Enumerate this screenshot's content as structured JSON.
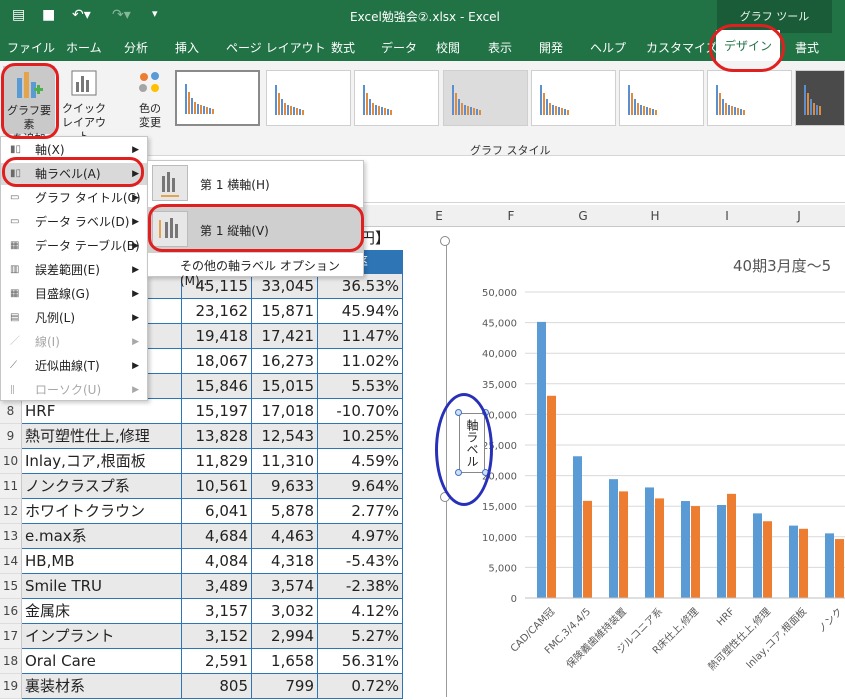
{
  "window": {
    "title": "Excel勉強会②.xlsx  -  Excel",
    "context_tab": "グラフ ツール",
    "quick_access": [
      "save-icon",
      "undo-icon",
      "redo-icon",
      "customize-icon"
    ]
  },
  "menu": {
    "items": [
      "ファイル",
      "ホーム",
      "分析",
      "挿入",
      "ページ レイアウト",
      "数式",
      "データ",
      "校閲",
      "表示",
      "開発",
      "ヘルプ",
      "カスタマイズ",
      "デザイン",
      "書式"
    ],
    "active": "デザイン"
  },
  "ribbon": {
    "add_element": "グラフ要素を追加",
    "add_element_l1": "グラフ要素",
    "add_element_l2": "を追加",
    "quick_layout_l1": "クイック",
    "quick_layout_l2": "レイアウト",
    "colors_l1": "色の",
    "colors_l2": "変更",
    "group_label": "グラフ スタイル"
  },
  "element_menu": [
    {
      "label": "軸(X)",
      "enabled": true,
      "submenu": true
    },
    {
      "label": "軸ラベル(A)",
      "enabled": true,
      "submenu": true
    },
    {
      "label": "グラフ タイトル(C)",
      "enabled": true,
      "submenu": true
    },
    {
      "label": "データ ラベル(D)",
      "enabled": true,
      "submenu": true
    },
    {
      "label": "データ テーブル(B)",
      "enabled": true,
      "submenu": true
    },
    {
      "label": "誤差範囲(E)",
      "enabled": true,
      "submenu": true
    },
    {
      "label": "目盛線(G)",
      "enabled": true,
      "submenu": true
    },
    {
      "label": "凡例(L)",
      "enabled": true,
      "submenu": true
    },
    {
      "label": "線(I)",
      "enabled": false,
      "submenu": true
    },
    {
      "label": "近似曲線(T)",
      "enabled": true,
      "submenu": true
    },
    {
      "label": "ローソク(U)",
      "enabled": false,
      "submenu": true
    }
  ],
  "axis_label_submenu": {
    "primary_horizontal": "第 1 横軸(H)",
    "primary_vertical": "第 1 縦軸(V)",
    "more_options": "その他の軸ラベル オプション(M)..."
  },
  "sheet": {
    "columns": [
      "E",
      "F",
      "G",
      "H",
      "I",
      "J"
    ],
    "partial_header": "円】",
    "rate_header": "率",
    "row_numbers": [
      "8",
      "9",
      "10",
      "11",
      "12",
      "13",
      "14",
      "15",
      "16",
      "17",
      "18",
      "19"
    ],
    "top_rows": [
      {
        "name": "",
        "a": "45,115",
        "b": "33,045",
        "c": "36.53%"
      },
      {
        "name": "",
        "a": "23,162",
        "b": "15,871",
        "c": "45.94%"
      },
      {
        "name": "置",
        "a": "19,418",
        "b": "17,421",
        "c": "11.47%"
      },
      {
        "name": "",
        "a": "18,067",
        "b": "16,273",
        "c": "11.02%"
      },
      {
        "name": "",
        "a": "15,846",
        "b": "15,015",
        "c": "5.53%"
      }
    ],
    "rows": [
      {
        "name": "HRF",
        "a": "15,197",
        "b": "17,018",
        "c": "-10.70%"
      },
      {
        "name": "熱可塑性仕上,修理",
        "a": "13,828",
        "b": "12,543",
        "c": "10.25%"
      },
      {
        "name": "Inlay,コア,根面板",
        "a": "11,829",
        "b": "11,310",
        "c": "4.59%"
      },
      {
        "name": "ノンクラスプ系",
        "a": "10,561",
        "b": "9,633",
        "c": "9.64%"
      },
      {
        "name": "ホワイトクラウン",
        "a": "6,041",
        "b": "5,878",
        "c": "2.77%"
      },
      {
        "name": "e.max系",
        "a": "4,684",
        "b": "4,463",
        "c": "4.97%"
      },
      {
        "name": "HB,MB",
        "a": "4,084",
        "b": "4,318",
        "c": "-5.43%"
      },
      {
        "name": "Smile TRU",
        "a": "3,489",
        "b": "3,574",
        "c": "-2.38%"
      },
      {
        "name": "金属床",
        "a": "3,157",
        "b": "3,032",
        "c": "4.12%"
      },
      {
        "name": "インプラント",
        "a": "3,152",
        "b": "2,994",
        "c": "5.27%"
      },
      {
        "name": "Oral Care",
        "a": "2,591",
        "b": "1,658",
        "c": "56.31%"
      },
      {
        "name": "裏装材系",
        "a": "805",
        "b": "799",
        "c": "0.72%"
      }
    ]
  },
  "axis_label_placeholder": "軸ラベル",
  "colors": {
    "excel_green": "#217346",
    "series1": "#5b9bd5",
    "series2": "#ed7d31",
    "annotation_red": "#e02020",
    "annotation_blue": "#2730b8"
  },
  "chart_data": {
    "type": "bar",
    "title": "40期3月度～5",
    "ylim": [
      0,
      50000
    ],
    "yticks": [
      "0",
      "5,000",
      "10,000",
      "15,000",
      "20,000",
      "25,000",
      "30,000",
      "35,000",
      "40,000",
      "45,000",
      "50,000"
    ],
    "categories": [
      "CAD/CAM冠",
      "FMC,3/4,4/5",
      "保険義歯維持装置",
      "ジルコニア系",
      "R床仕上,修理",
      "HRF",
      "熱可塑性仕上,修理",
      "Inlay,コア,根面板",
      "ノンク"
    ],
    "series": [
      {
        "values": [
          45115,
          23162,
          19418,
          18067,
          15846,
          15197,
          13828,
          11829,
          10561
        ]
      },
      {
        "values": [
          33045,
          15871,
          17421,
          16273,
          15015,
          17018,
          12543,
          11310,
          9633
        ]
      }
    ],
    "grid": true
  }
}
